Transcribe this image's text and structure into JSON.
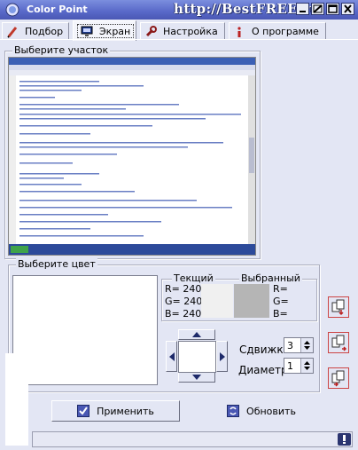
{
  "window": {
    "title": "Color Point",
    "watermark": "http://BestFREE.ru"
  },
  "tabs": [
    {
      "label": "Подбор",
      "icon": "pen-icon"
    },
    {
      "label": "Экран",
      "icon": "monitor-icon",
      "active": true
    },
    {
      "label": "Настройка",
      "icon": "wrench-icon"
    },
    {
      "label": "О программе",
      "icon": "info-icon"
    }
  ],
  "screen_group": {
    "title": "Выберите участок"
  },
  "color_group": {
    "title": "Выберите цвет"
  },
  "current": {
    "title": "Текщий",
    "r": "R= 240",
    "g": "G= 240",
    "b": "B= 240",
    "color": "#f0f0f0"
  },
  "selected": {
    "title": "Выбранный",
    "r": "R=",
    "g": "G=",
    "b": "B=",
    "color": "#b5b5b5"
  },
  "shift": {
    "label": "Сдвижка",
    "value": "3"
  },
  "diameter": {
    "label": "Диаметр",
    "value": "1"
  },
  "buttons": {
    "apply": "Применить",
    "refresh": "Обновить"
  },
  "colors": {
    "accent": "#4a58b4",
    "face": "#e3e6f4"
  }
}
